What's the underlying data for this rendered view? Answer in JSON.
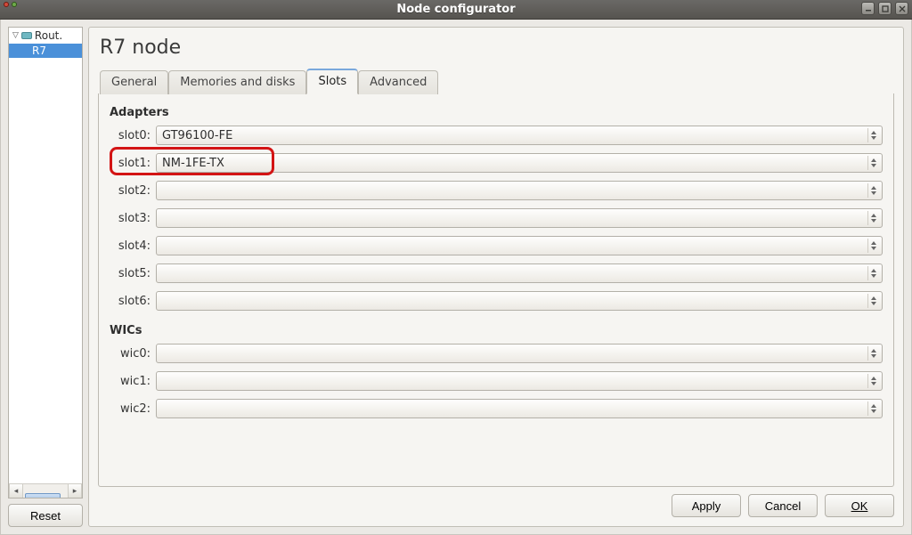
{
  "window": {
    "title": "Node configurator"
  },
  "sidebar": {
    "root_label": "Rout.",
    "selected_node": "R7",
    "reset_label": "Reset"
  },
  "main": {
    "title": "R7 node",
    "tabs": {
      "general": "General",
      "memories": "Memories and disks",
      "slots": "Slots",
      "advanced": "Advanced"
    },
    "active_tab": "slots",
    "adapters_header": "Adapters",
    "wics_header": "WICs",
    "slots": [
      {
        "label": "slot0:",
        "value": "GT96100-FE"
      },
      {
        "label": "slot1:",
        "value": "NM-1FE-TX"
      },
      {
        "label": "slot2:",
        "value": ""
      },
      {
        "label": "slot3:",
        "value": ""
      },
      {
        "label": "slot4:",
        "value": ""
      },
      {
        "label": "slot5:",
        "value": ""
      },
      {
        "label": "slot6:",
        "value": ""
      }
    ],
    "wics": [
      {
        "label": "wic0:",
        "value": ""
      },
      {
        "label": "wic1:",
        "value": ""
      },
      {
        "label": "wic2:",
        "value": ""
      }
    ],
    "highlighted_slot_index": 1
  },
  "footer": {
    "apply": "Apply",
    "cancel": "Cancel",
    "ok": "OK"
  }
}
